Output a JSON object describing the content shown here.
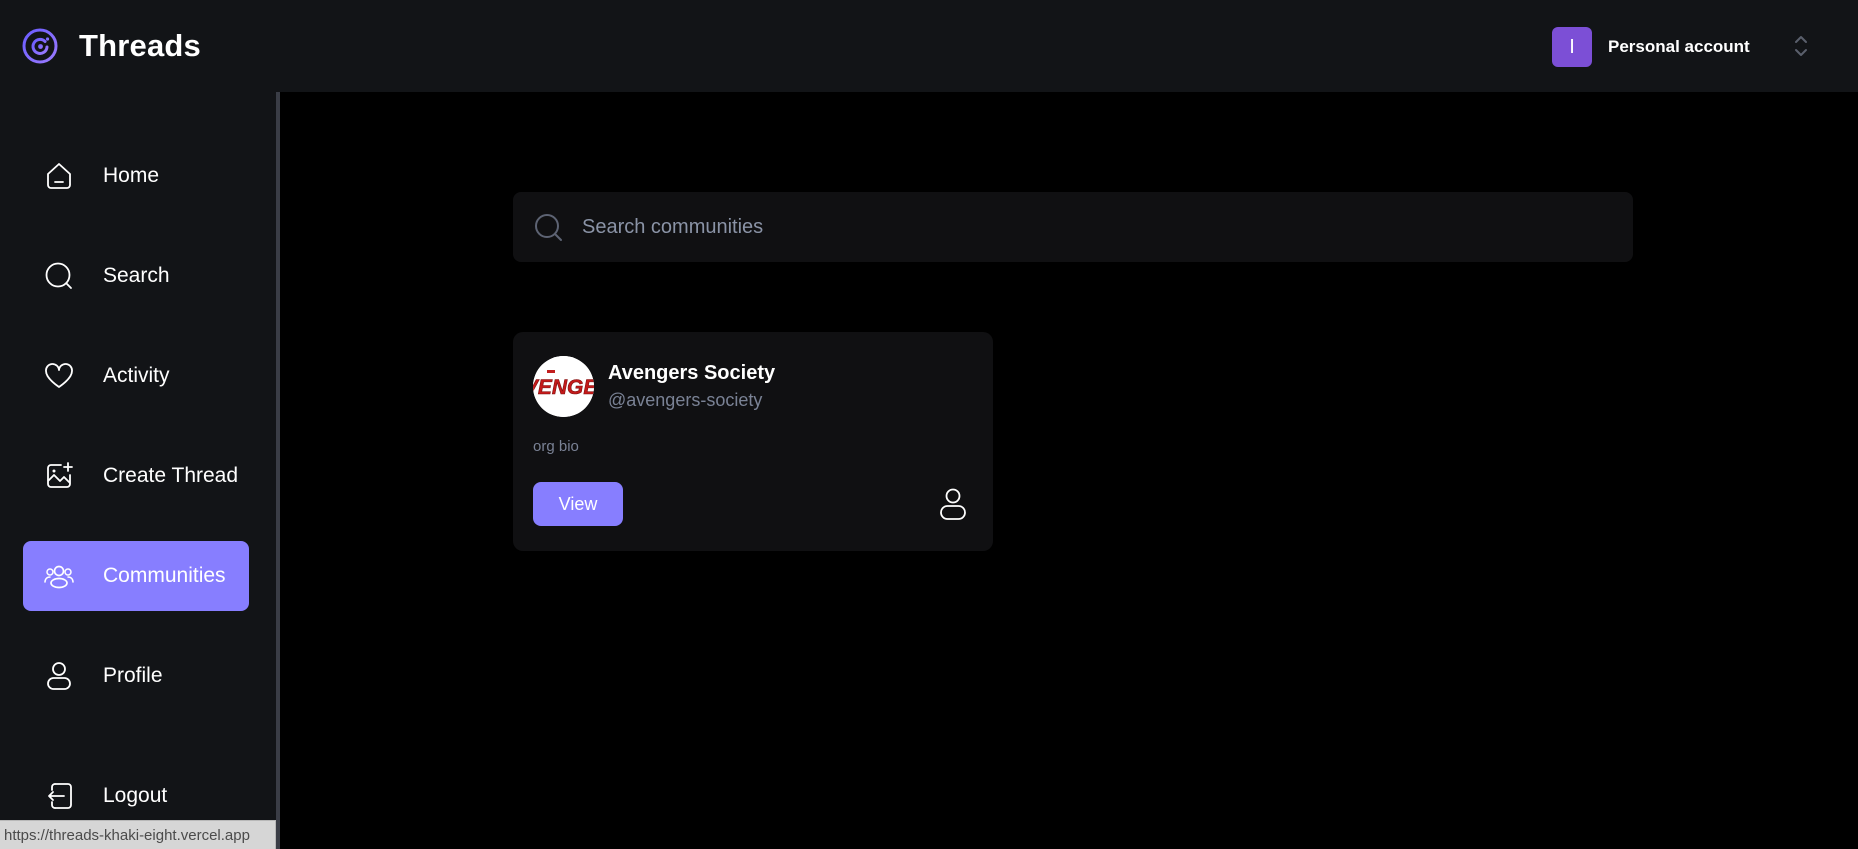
{
  "app": {
    "title": "Threads",
    "accent_color": "#877eff",
    "logo_icon": "threads-logo-icon"
  },
  "account": {
    "avatar_initial": "I",
    "name": "Personal account",
    "switcher_icon": "chevron-up-down-icon"
  },
  "sidebar": {
    "items": [
      {
        "label": "Home",
        "icon": "home-icon",
        "active": false
      },
      {
        "label": "Search",
        "icon": "search-icon",
        "active": false
      },
      {
        "label": "Activity",
        "icon": "heart-icon",
        "active": false
      },
      {
        "label": "Create Thread",
        "icon": "create-image-icon",
        "active": false
      },
      {
        "label": "Communities",
        "icon": "communities-icon",
        "active": true
      },
      {
        "label": "Profile",
        "icon": "user-icon",
        "active": false
      },
      {
        "label": "Logout",
        "icon": "logout-icon",
        "active": false
      }
    ]
  },
  "search": {
    "placeholder": "Search communities",
    "value": ""
  },
  "communities": [
    {
      "name": "Avengers Society",
      "handle": "@avengers-society",
      "bio": "org bio",
      "logo_text": "VENGEI",
      "view_label": "View",
      "members_icon": "user-icon"
    }
  ],
  "status_url": "https://threads-khaki-eight.vercel.app"
}
